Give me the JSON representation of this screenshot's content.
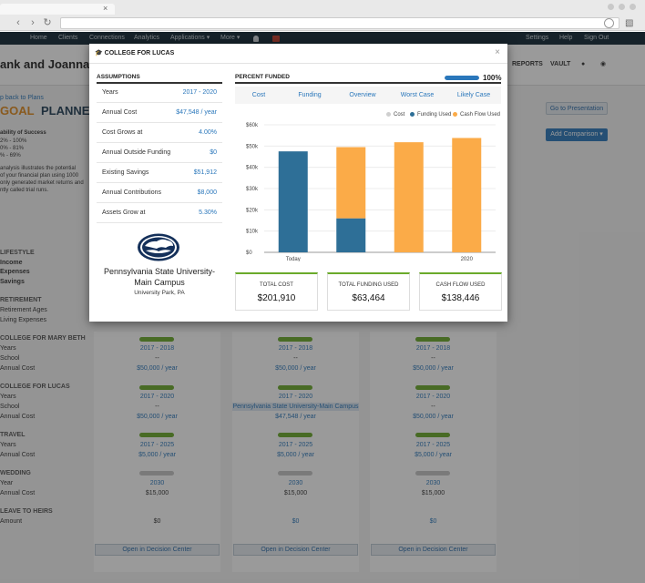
{
  "browser": {
    "tab_close": "×"
  },
  "appnav": {
    "items": [
      "Home",
      "Clients",
      "Connections",
      "Analytics",
      "Applications ▾",
      "More ▾"
    ],
    "right_items": [
      "Settings",
      "Help",
      "Sign Out"
    ]
  },
  "background": {
    "client_name": "ank and Joanna Mill",
    "header_links": [
      "REPORTS",
      "VAULT"
    ],
    "back_link": "p back to Plans",
    "app_title_prefix": "GOAL",
    "app_title_suffix": "PLANNER",
    "go_to_presentation": "Go to Presentation",
    "add_comparison": "Add Comparison ▾",
    "probability_title": "ability of Success",
    "probability_lines": [
      "2% - 100%",
      "0% - 81%",
      "% - 69%"
    ],
    "description_lines": [
      "analysis illustrates the potential",
      "of your financial plan using 1000",
      "only generated market returns and",
      "ntly called trial runs."
    ],
    "left_labels": [
      {
        "text": "LIFESTYLE",
        "kind": "section"
      },
      {
        "text": "Income",
        "kind": "bold"
      },
      {
        "text": "Expenses",
        "kind": "bold"
      },
      {
        "text": "Savings",
        "kind": "bold"
      },
      {
        "text": "RETIREMENT",
        "kind": "section"
      },
      {
        "text": "Retirement Ages",
        "kind": "normal"
      },
      {
        "text": "Living Expenses",
        "kind": "normal"
      },
      {
        "text": "COLLEGE FOR MARY BETH",
        "kind": "section"
      },
      {
        "text": "Years",
        "kind": "normal"
      },
      {
        "text": "School",
        "kind": "normal"
      },
      {
        "text": "Annual Cost",
        "kind": "normal"
      },
      {
        "text": "COLLEGE FOR LUCAS",
        "kind": "section"
      },
      {
        "text": "Years",
        "kind": "normal"
      },
      {
        "text": "School",
        "kind": "normal"
      },
      {
        "text": "Annual Cost",
        "kind": "normal"
      },
      {
        "text": "TRAVEL",
        "kind": "section"
      },
      {
        "text": "Years",
        "kind": "normal"
      },
      {
        "text": "Annual Cost",
        "kind": "normal"
      },
      {
        "text": "WEDDING",
        "kind": "section"
      },
      {
        "text": "Year",
        "kind": "normal"
      },
      {
        "text": "Annual Cost",
        "kind": "normal"
      },
      {
        "text": "LEAVE TO HEIRS",
        "kind": "section"
      },
      {
        "text": "Amount",
        "kind": "normal"
      }
    ],
    "columns": [
      {
        "mary_years": "2017 - 2018",
        "mary_school": "--",
        "mary_cost": "$50,000 / year",
        "lucas_years": "2017 - 2020",
        "lucas_school": "--",
        "lucas_cost": "$50,000 / year",
        "travel_years": "2017 - 2025",
        "travel_cost": "$5,000 / year",
        "wedding_year": "2030",
        "wedding_cost": "$15,000",
        "heirs": "$0",
        "open_button": "Open in Decision Center"
      },
      {
        "mary_years": "2017 - 2018",
        "mary_school": "--",
        "mary_cost": "$50,000 / year",
        "lucas_years": "2017 - 2020",
        "lucas_school": "Pennsylvania State University-Main Campus",
        "lucas_cost": "$47,548 / year",
        "travel_years": "2017 - 2025",
        "travel_cost": "$5,000 / year",
        "wedding_year": "2030",
        "wedding_cost": "$15,000",
        "heirs": "$0",
        "open_button": "Open in Decision Center"
      },
      {
        "mary_years": "2017 - 2018",
        "mary_school": "--",
        "mary_cost": "$50,000 / year",
        "lucas_years": "2017 - 2020",
        "lucas_school": "--",
        "lucas_cost": "$50,000 / year",
        "travel_years": "2017 - 2025",
        "travel_cost": "$5,000 / year",
        "wedding_year": "2030",
        "wedding_cost": "$15,000",
        "heirs": "$0",
        "open_button": "Open in Decision Center"
      }
    ]
  },
  "modal": {
    "title": "COLLEGE FOR LUCAS",
    "close": "×",
    "assumptions_title": "ASSUMPTIONS",
    "assumptions": [
      {
        "label": "Years",
        "value": "2017 - 2020"
      },
      {
        "label": "Annual Cost",
        "value": "$47,548 / year"
      },
      {
        "label": "Cost Grows at",
        "value": "4.00%"
      },
      {
        "label": "Annual Outside Funding",
        "value": "$0"
      },
      {
        "label": "Existing Savings",
        "value": "$51,912"
      },
      {
        "label": "Annual Contributions",
        "value": "$8,000"
      },
      {
        "label": "Assets Grow at",
        "value": "5.30%"
      }
    ],
    "school_name": "Pennsylvania State University-Main Campus",
    "school_location": "University Park, PA",
    "percent_funded_title": "PERCENT FUNDED",
    "percent_funded_value": "100%",
    "percent_funded_fraction": 1.0,
    "tabs": [
      "Cost",
      "Funding",
      "Overview",
      "Worst Case",
      "Likely Case"
    ],
    "active_tab": 2,
    "legend": [
      {
        "label": "Cost",
        "color": "#cfcfcf"
      },
      {
        "label": "Funding Used",
        "color": "#2e6f97"
      },
      {
        "label": "Cash Flow Used",
        "color": "#fbab48"
      }
    ],
    "summary": [
      {
        "label": "TOTAL COST",
        "value": "$201,910"
      },
      {
        "label": "TOTAL FUNDING USED",
        "value": "$63,464"
      },
      {
        "label": "CASH FLOW USED",
        "value": "$138,446"
      }
    ]
  },
  "chart_data": {
    "type": "bar",
    "stacked": true,
    "categories": [
      "Today",
      "",
      "",
      "2020"
    ],
    "series": [
      {
        "name": "Funding Used",
        "color": "#2e6f97",
        "values": [
          47500,
          16000,
          0,
          0
        ]
      },
      {
        "name": "Cash Flow Used",
        "color": "#fbab48",
        "values": [
          0,
          33500,
          51800,
          53800
        ]
      }
    ],
    "ylim": [
      0,
      60000
    ],
    "yticks": [
      0,
      10000,
      20000,
      30000,
      40000,
      50000,
      60000
    ],
    "ytick_labels": [
      "$0",
      "$10k",
      "$20k",
      "$30k",
      "$40k",
      "$50k",
      "$60k"
    ],
    "grid": true,
    "legend": "top-right"
  }
}
